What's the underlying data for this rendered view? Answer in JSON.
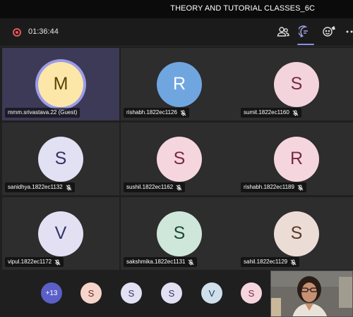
{
  "window": {
    "title": "THEORY AND TUTORIAL CLASSES_6C"
  },
  "toolbar": {
    "timer": "01:36:44",
    "icons": [
      "record-icon",
      "participants-icon",
      "chat-icon",
      "reactions-icon",
      "more-icon"
    ]
  },
  "participants": [
    {
      "initial": "M",
      "name": "mmm.srivastava.22 (Guest)",
      "muted": false,
      "speaking": true,
      "bg": "#fde7a8",
      "fg": "#5a4207"
    },
    {
      "initial": "R",
      "name": "rishabh.1822ec1126",
      "muted": true,
      "speaking": false,
      "bg": "#6fa6e0",
      "fg": "#ffffff"
    },
    {
      "initial": "S",
      "name": "sumit.1822ec1160",
      "muted": true,
      "speaking": false,
      "bg": "#f3d3dc",
      "fg": "#7a2940"
    },
    {
      "initial": "S",
      "name": "sanidhya.1822ec1132",
      "muted": true,
      "speaking": false,
      "bg": "#e2e0f3",
      "fg": "#333366"
    },
    {
      "initial": "S",
      "name": "sushil.1822ec1162",
      "muted": true,
      "speaking": false,
      "bg": "#f6d6de",
      "fg": "#7a2940"
    },
    {
      "initial": "R",
      "name": "rishabh.1822ec1189",
      "muted": true,
      "speaking": false,
      "bg": "#f6d6de",
      "fg": "#7a2940"
    },
    {
      "initial": "V",
      "name": "vipul.1822ec1172",
      "muted": true,
      "speaking": false,
      "bg": "#e4e0f4",
      "fg": "#333366"
    },
    {
      "initial": "S",
      "name": "sakshmika.1822ec1131",
      "muted": true,
      "speaking": false,
      "bg": "#cfe7da",
      "fg": "#1e4a36"
    },
    {
      "initial": "S",
      "name": "sahil.1822ec1129",
      "muted": true,
      "speaking": false,
      "bg": "#ecdcd6",
      "fg": "#5a3a2a"
    }
  ],
  "overflow": {
    "count_label": "+13",
    "avatars": [
      {
        "initial": "S",
        "bg": "#f5d4cc",
        "fg": "#6b2a1a"
      },
      {
        "initial": "S",
        "bg": "#e2e0f3",
        "fg": "#333366"
      },
      {
        "initial": "S",
        "bg": "#e2e0f3",
        "fg": "#333366"
      },
      {
        "initial": "V",
        "bg": "#cfe0ec",
        "fg": "#1e3a5a"
      },
      {
        "initial": "S",
        "bg": "#f6d6de",
        "fg": "#7a2940"
      }
    ]
  },
  "colors": {
    "accent": "#8d8fe8",
    "record": "#e5545b",
    "tile": "#2d2d2d",
    "active_tile": "#3c3a56"
  }
}
